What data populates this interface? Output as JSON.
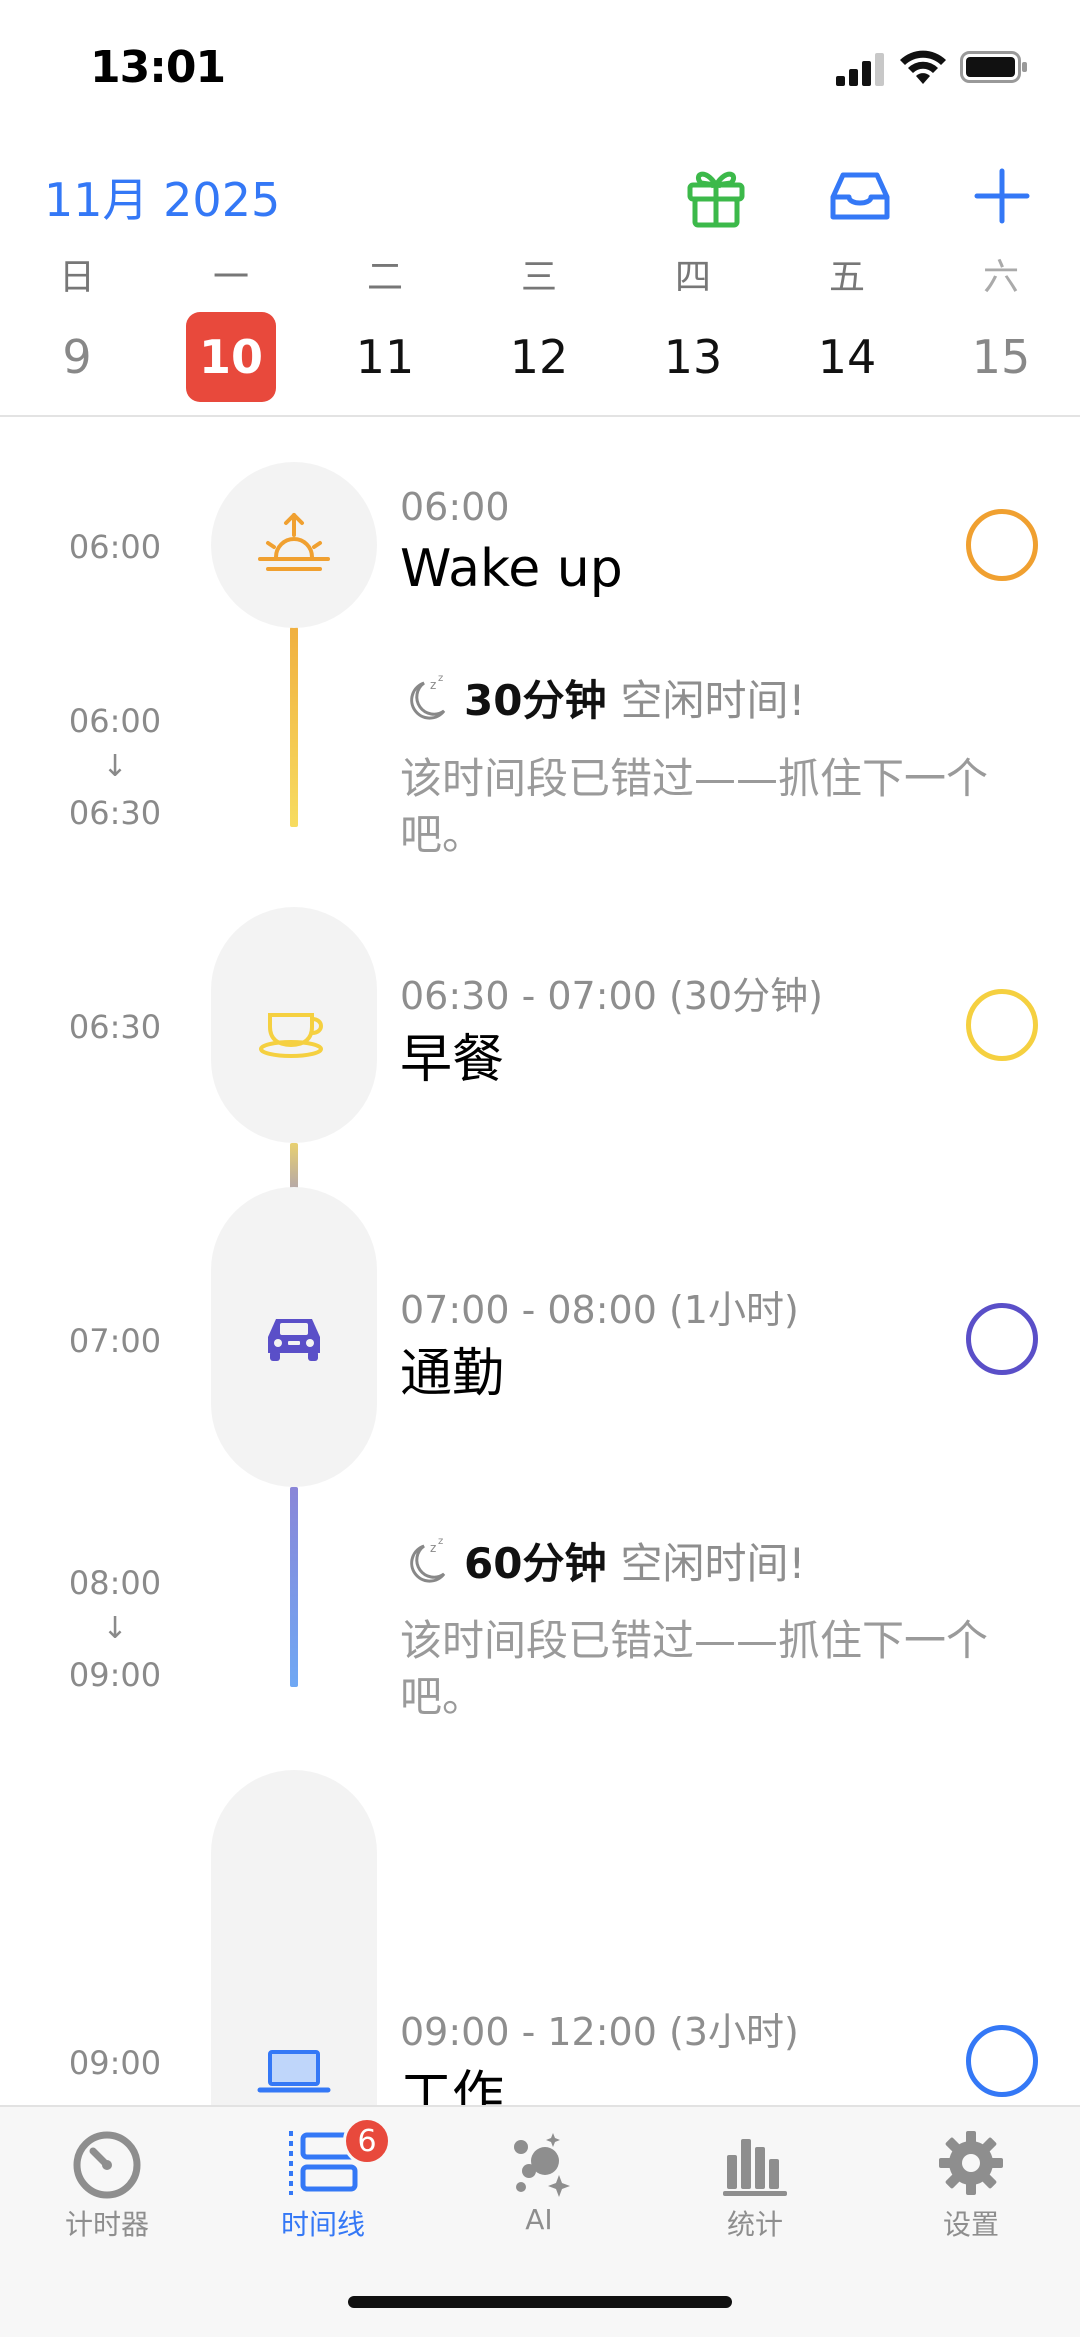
{
  "status_bar": {
    "time": "13:01"
  },
  "header": {
    "month_title": "11月 2025",
    "gift_icon": "gift-icon",
    "inbox_icon": "inbox-icon",
    "add_icon": "plus-icon",
    "accent": "#3478F6"
  },
  "week": {
    "weekdays": [
      "日",
      "一",
      "二",
      "三",
      "四",
      "五",
      "六"
    ],
    "dates": [
      "9",
      "10",
      "11",
      "12",
      "13",
      "14",
      "15"
    ],
    "selected_date": "10",
    "selected_color": "#E8493C"
  },
  "timeline": {
    "events": [
      {
        "time_label": "06:00",
        "time_range": "06:00",
        "title": "Wake up",
        "icon": "sunrise-icon",
        "color": "#F0A030"
      },
      {
        "time_label": "06:30",
        "time_range": "06:30 - 07:00 (30分钟)",
        "title": "早餐",
        "icon": "coffee-cup-icon",
        "color": "#F5D040"
      },
      {
        "time_label": "07:00",
        "time_range": "07:00 - 08:00 (1小时)",
        "title": "通勤",
        "icon": "car-icon",
        "color": "#5A4FC8"
      },
      {
        "time_label": "09:00",
        "time_range": "09:00 - 12:00 (3小时)",
        "title": "工作",
        "icon": "laptop-icon",
        "color": "#3478F6"
      }
    ],
    "free_slots": [
      {
        "start": "06:00",
        "arrow": "↓",
        "end": "06:30",
        "duration": "30分钟",
        "label": "空闲时间!",
        "note": "该时间段已错过——抓住下一个吧。",
        "icon": "sleep-moon-icon"
      },
      {
        "start": "08:00",
        "arrow": "↓",
        "end": "09:00",
        "duration": "60分钟",
        "label": "空闲时间!",
        "note": "该时间段已错过——抓住下一个吧。",
        "icon": "sleep-moon-icon"
      }
    ]
  },
  "tabbar": {
    "tabs": [
      {
        "label": "计时器",
        "icon": "timer-icon"
      },
      {
        "label": "时间线",
        "icon": "timeline-icon",
        "badge": "6",
        "active": true
      },
      {
        "label": "AI",
        "icon": "ai-sparkle-icon"
      },
      {
        "label": "统计",
        "icon": "stats-bars-icon"
      },
      {
        "label": "设置",
        "icon": "gear-icon"
      }
    ],
    "active_color": "#3478F6"
  }
}
